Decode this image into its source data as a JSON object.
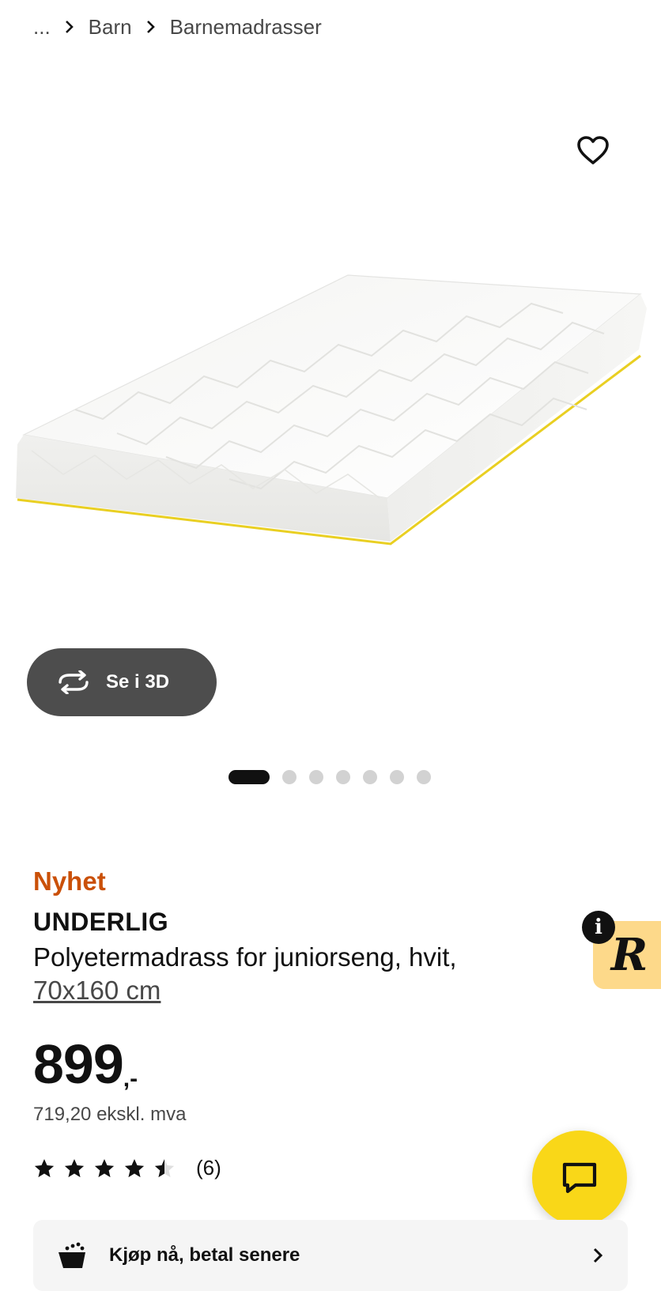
{
  "breadcrumb": {
    "ellipsis": "...",
    "items": [
      "Barn",
      "Barnemadrasser"
    ]
  },
  "gallery": {
    "view3d_label": "Se i 3D",
    "dot_count": 7,
    "active_index": 0
  },
  "product": {
    "badge": "Nyhet",
    "name": "UNDERLIG",
    "description": "Polyetermadrass for juniorseng, hvit,",
    "size": "70x160 cm",
    "price_integer": "899",
    "price_decimal": ",-",
    "price_ex_vat": "719,20 ekskl. mva",
    "rating": 4.5,
    "rating_max": 5,
    "review_count": "(6)"
  },
  "partner": {
    "info_glyph": "i",
    "logo_letter": "R"
  },
  "bnpl": {
    "label": "Kjøp nå, betal senere"
  },
  "colors": {
    "badge_new": "#ca5008",
    "chat_fab": "#f9d718",
    "partner_tab": "#fdd98a",
    "view3d_bg": "#4d4d4d"
  },
  "icons": {
    "favourite": "heart-outline-icon",
    "view3d": "rotate-3d-icon",
    "chat": "chat-bubble-icon",
    "bnpl": "shopping-cart-icon",
    "chevron": "chevron-right-icon"
  }
}
